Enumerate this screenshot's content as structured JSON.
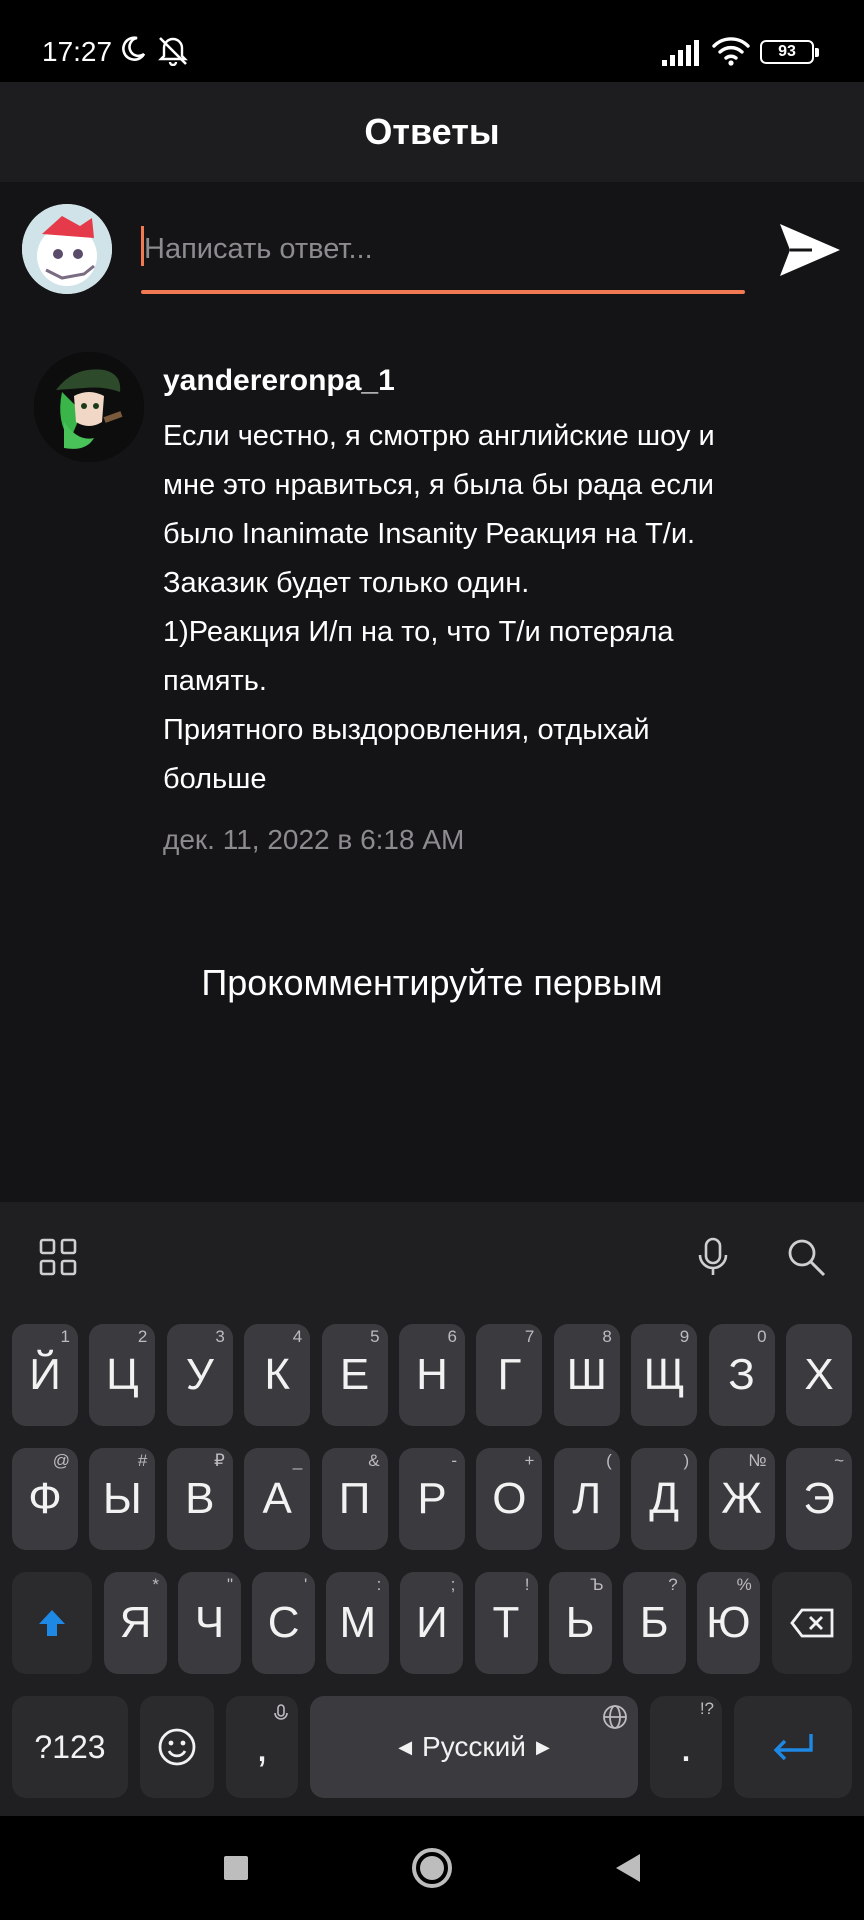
{
  "status_bar": {
    "time": "17:27",
    "battery": "93",
    "icons": [
      "moon-icon",
      "bell-off-icon",
      "signal-icon",
      "wifi-icon",
      "battery-icon"
    ]
  },
  "header": {
    "title": "Ответы"
  },
  "reply": {
    "placeholder": "Написать ответ...",
    "send_icon": "send-icon",
    "accent_color": "#f17a52"
  },
  "comment": {
    "username": "yandereronpa_1",
    "text": "Если честно, я смотрю английские шоу и\nмне это нравиться, я была бы рада если\nбыло Inanimate Insanity Реакция на Т/и.\nЗаказик будет только один.\n1)Реакция И/п на то, что Т/и потеряла\nпамять.\nПриятного выздоровления, отдыхай\nбольше",
    "date": "дек. 11, 2022 в 6:18 AM"
  },
  "empty_state": "Прокомментируйте первым",
  "keyboard": {
    "toolbar_icons": [
      "grid-icon",
      "microphone-icon",
      "search-icon"
    ],
    "row1": [
      {
        "label": "Й",
        "hint": "1"
      },
      {
        "label": "Ц",
        "hint": "2"
      },
      {
        "label": "У",
        "hint": "3"
      },
      {
        "label": "К",
        "hint": "4"
      },
      {
        "label": "Е",
        "hint": "5"
      },
      {
        "label": "Н",
        "hint": "6"
      },
      {
        "label": "Г",
        "hint": "7"
      },
      {
        "label": "Ш",
        "hint": "8"
      },
      {
        "label": "Щ",
        "hint": "9"
      },
      {
        "label": "З",
        "hint": "0"
      },
      {
        "label": "Х",
        "hint": ""
      }
    ],
    "row2": [
      {
        "label": "Ф",
        "hint": "@"
      },
      {
        "label": "Ы",
        "hint": "#"
      },
      {
        "label": "В",
        "hint": "₽"
      },
      {
        "label": "А",
        "hint": "_"
      },
      {
        "label": "П",
        "hint": "&"
      },
      {
        "label": "Р",
        "hint": "-"
      },
      {
        "label": "О",
        "hint": "+"
      },
      {
        "label": "Л",
        "hint": "("
      },
      {
        "label": "Д",
        "hint": ")"
      },
      {
        "label": "Ж",
        "hint": "№"
      },
      {
        "label": "Э",
        "hint": "~"
      }
    ],
    "row3": [
      {
        "label": "Я",
        "hint": "*"
      },
      {
        "label": "Ч",
        "hint": "\""
      },
      {
        "label": "С",
        "hint": "'"
      },
      {
        "label": "М",
        "hint": ":"
      },
      {
        "label": "И",
        "hint": ";"
      },
      {
        "label": "Т",
        "hint": "!"
      },
      {
        "label": "Ь",
        "hint": "Ъ"
      },
      {
        "label": "Б",
        "hint": "?"
      },
      {
        "label": "Ю",
        "hint": "%"
      }
    ],
    "symbols_label": "?123",
    "comma_label": ",",
    "space_label": "Русский",
    "period_label": ".",
    "period_hint": "!?",
    "shift_icon": "shift-icon",
    "backspace_icon": "backspace-icon",
    "enter_icon": "enter-icon",
    "emoji_icon": "emoji-icon",
    "globe_icon": "globe-icon",
    "accent_color": "#1e88e5"
  },
  "nav_bar": {
    "icons": [
      "recents-icon",
      "home-icon",
      "back-icon"
    ]
  }
}
